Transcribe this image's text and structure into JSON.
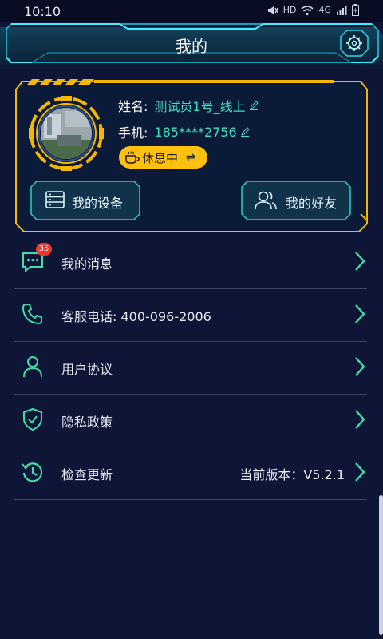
{
  "status_bar": {
    "time": "10:10",
    "hd_label": "HD",
    "network_label": "4G"
  },
  "header": {
    "title": "我的",
    "settings_icon": "gear-icon"
  },
  "profile": {
    "name_label": "姓名:",
    "name_value": "测试员1号_线上",
    "phone_label": "手机:",
    "phone_value": "185****2756",
    "status_text": "休息中",
    "status_color": "#ffc10f",
    "accent_color": "#3fe0c2",
    "frame_color": "#f5b800"
  },
  "card_buttons": {
    "devices": "我的设备",
    "friends": "我的好友"
  },
  "menu": {
    "messages": {
      "label": "我的消息",
      "badge": "35",
      "icon": "message-icon"
    },
    "service": {
      "label": "客服电话: 400-096-2006",
      "icon": "phone-icon"
    },
    "agreement": {
      "label": "用户协议",
      "icon": "user-icon"
    },
    "privacy": {
      "label": "隐私政策",
      "icon": "shield-icon"
    },
    "update": {
      "label": "检查更新",
      "version": "当前版本：V5.2.1",
      "icon": "history-icon"
    }
  }
}
